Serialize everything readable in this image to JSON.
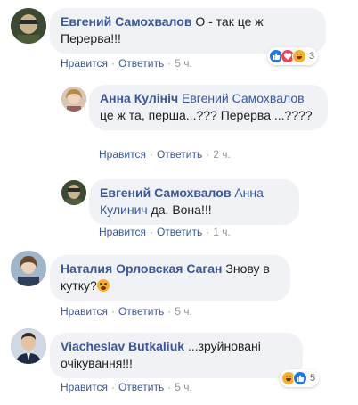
{
  "actions": {
    "like": "Нравится",
    "reply": "Ответить",
    "separator": "·"
  },
  "colors": {
    "link": "#385898",
    "bubble": "#f0f2f5",
    "muted": "#606770",
    "like": "#1877f2",
    "love": "#f33e58",
    "haha": "#f7b125"
  },
  "comments": [
    {
      "author": "Евгений Самохвалов",
      "text": "О - так це ж Перерва!!!",
      "time": "5 ч.",
      "reactions": {
        "icons": [
          "like-icon",
          "love-icon",
          "haha-icon"
        ],
        "count": "3"
      }
    },
    {
      "author": "Анна Кулініч",
      "reply_to": "Евгений Самохвалов",
      "text": "це ж та, перша...??? Перерва ...????",
      "time": "2 ч."
    },
    {
      "author": "Евгений Самохвалов",
      "reply_to": "Анна Кулинич",
      "text": "да. Вона!!!",
      "time": "1 ч."
    },
    {
      "author": "Наталия Орловская Саган",
      "text": "Знову в кутку?",
      "emoji": "astonished-face-icon",
      "time": "5 ч."
    },
    {
      "author": "Viacheslav Butkaliuk",
      "text": "...зруйновані очікування!!!",
      "time": "5 ч.",
      "reactions": {
        "icons": [
          "haha-icon",
          "like-icon"
        ],
        "count": "5"
      }
    }
  ]
}
